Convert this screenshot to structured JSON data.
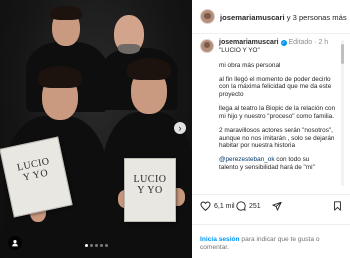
{
  "header": {
    "username": "josemariamuscari",
    "others": "y 3 personas más"
  },
  "photo": {
    "book_title_line1": "LUCIO",
    "book_title_line2": "Y YO",
    "carousel": {
      "slides": 5,
      "active": 0
    }
  },
  "caption": {
    "username": "josemariamuscari",
    "edited": "Editado",
    "separator": "·",
    "time": "2 h",
    "paragraphs": [
      "\"LUCIO Y YO\"",
      "mi obra más personal",
      "al fin llegó el momento de poder decirlo con la máxima felicidad que me da este proyecto",
      "llega al teatro la Biopic de la relación con mi hijo y nuestro \"proceso\" como familia.",
      "2 maravillosos actores serán \"nosotros\", aunque no nos imitarán , solo se dejarán habitar por nuestra historia"
    ],
    "last": {
      "mention": "@perezesteban_ok",
      "text_a": " con todo su",
      "text_b": "talento y sensibilidad hará de \"mi\""
    }
  },
  "actions": {
    "likes": "6,1 mil",
    "comments": "251"
  },
  "login": {
    "link": "Inicia sesión",
    "text": " para indicar que te gusta o comentar."
  },
  "colors": {
    "accent": "#0095f6",
    "mention": "#00376b",
    "muted": "#8e8e8e"
  }
}
